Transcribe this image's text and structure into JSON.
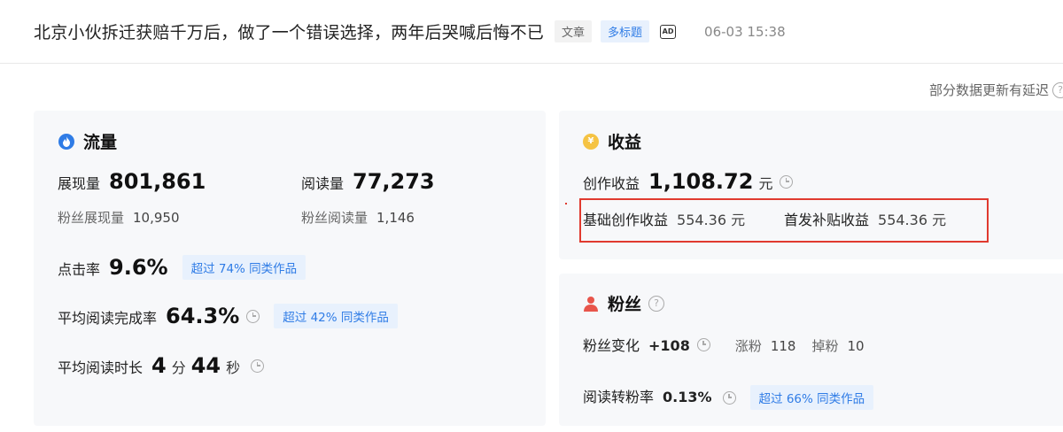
{
  "header": {
    "title": "北京小伙拆迁获赔千万后，做了一个错误选择，两年后哭喊后悔不已",
    "tag_article": "文章",
    "tag_multi_title": "多标题",
    "ad_icon_label": "AD",
    "time": "06-03 15:38"
  },
  "note": {
    "text": "部分数据更新有延迟",
    "icon": "question-icon"
  },
  "traffic": {
    "heading": "流量",
    "icon": "flame-icon",
    "impressions_label": "展现量",
    "impressions_value": "801,861",
    "reads_label": "阅读量",
    "reads_value": "77,273",
    "fan_impressions_label": "粉丝展现量",
    "fan_impressions_value": "10,950",
    "fan_reads_label": "粉丝阅读量",
    "fan_reads_value": "1,146",
    "ctr_label": "点击率",
    "ctr_value": "9.6%",
    "ctr_badge": "超过 74% 同类作品",
    "completion_label": "平均阅读完成率",
    "completion_value": "64.3%",
    "completion_badge": "超过 42% 同类作品",
    "duration_label": "平均阅读时长",
    "duration_min": "4",
    "duration_min_unit": "分",
    "duration_sec": "44",
    "duration_sec_unit": "秒"
  },
  "income": {
    "heading": "收益",
    "icon": "yen-coin-icon",
    "creation_label": "创作收益",
    "creation_value": "1,108.72",
    "creation_unit": "元",
    "base_label": "基础创作收益",
    "base_value": "554.36 元",
    "first_label": "首发补贴收益",
    "first_value": "554.36 元"
  },
  "fans": {
    "heading": "粉丝",
    "icon": "person-icon",
    "change_label": "粉丝变化",
    "change_value": "+108",
    "gain_label": "涨粉",
    "gain_value": "118",
    "loss_label": "掉粉",
    "loss_value": "10",
    "conversion_label": "阅读转粉率",
    "conversion_value": "0.13%",
    "conversion_badge": "超过 66% 同类作品"
  },
  "colors": {
    "accent_blue": "#2f7ce6",
    "badge_bg": "#e8f1fd",
    "highlight_red": "#e03a2f",
    "income_yellow": "#f5c343",
    "fans_red": "#e8554b"
  }
}
